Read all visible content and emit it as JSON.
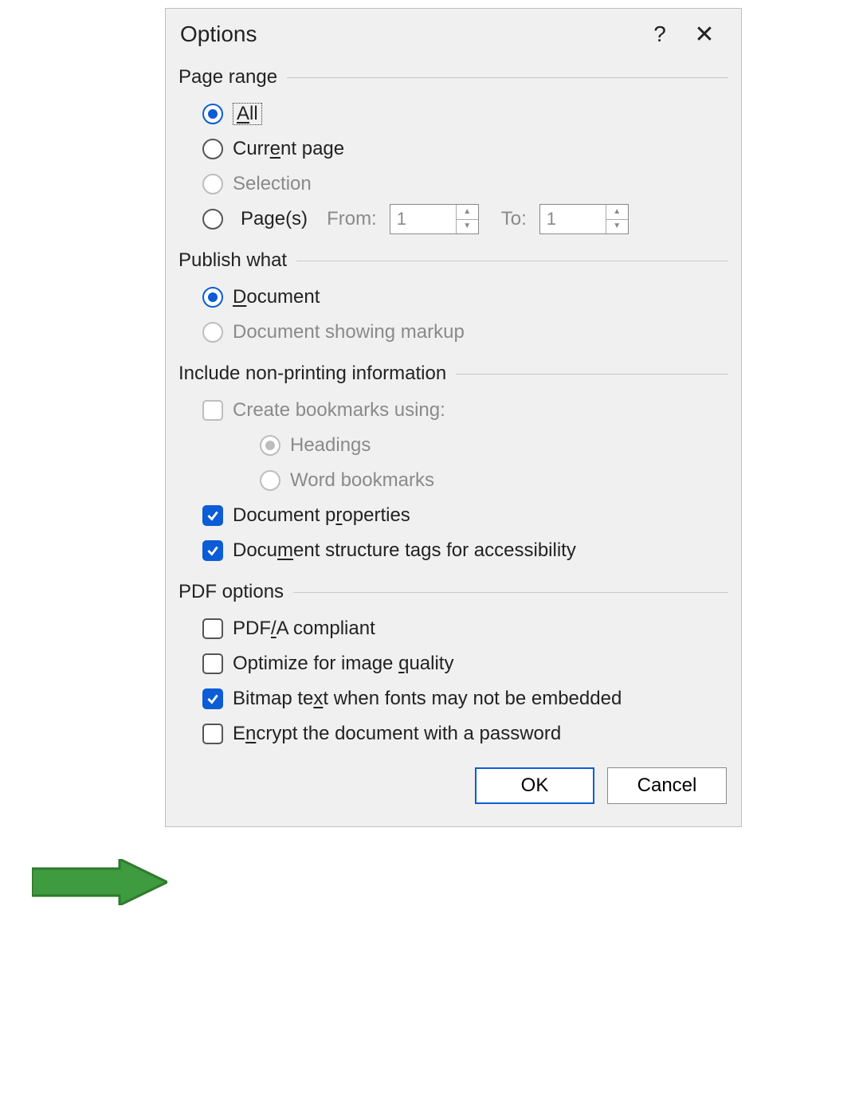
{
  "title": "Options",
  "titlebar": {
    "help": "?",
    "close": "✕"
  },
  "page_range": {
    "header": "Page range",
    "all": "All",
    "current": "Current page",
    "selection": "Selection",
    "pages": "Page(s)",
    "from_label": "From:",
    "to_label": "To:",
    "from_value": "1",
    "to_value": "1"
  },
  "publish": {
    "header": "Publish what",
    "document": "Document",
    "showing_markup": "Document showing markup"
  },
  "nonprinting": {
    "header": "Include non-printing information",
    "create_bookmarks": "Create bookmarks using:",
    "headings": "Headings",
    "word_bookmarks": "Word bookmarks",
    "doc_properties": "Document properties",
    "structure_tags": "Document structure tags for accessibility"
  },
  "pdf": {
    "header": "PDF options",
    "pdfa": "PDF/A compliant",
    "optimize_image": "Optimize for image quality",
    "bitmap_text": "Bitmap text when fonts may not be embedded",
    "encrypt": "Encrypt the document with a password"
  },
  "buttons": {
    "ok": "OK",
    "cancel": "Cancel"
  }
}
